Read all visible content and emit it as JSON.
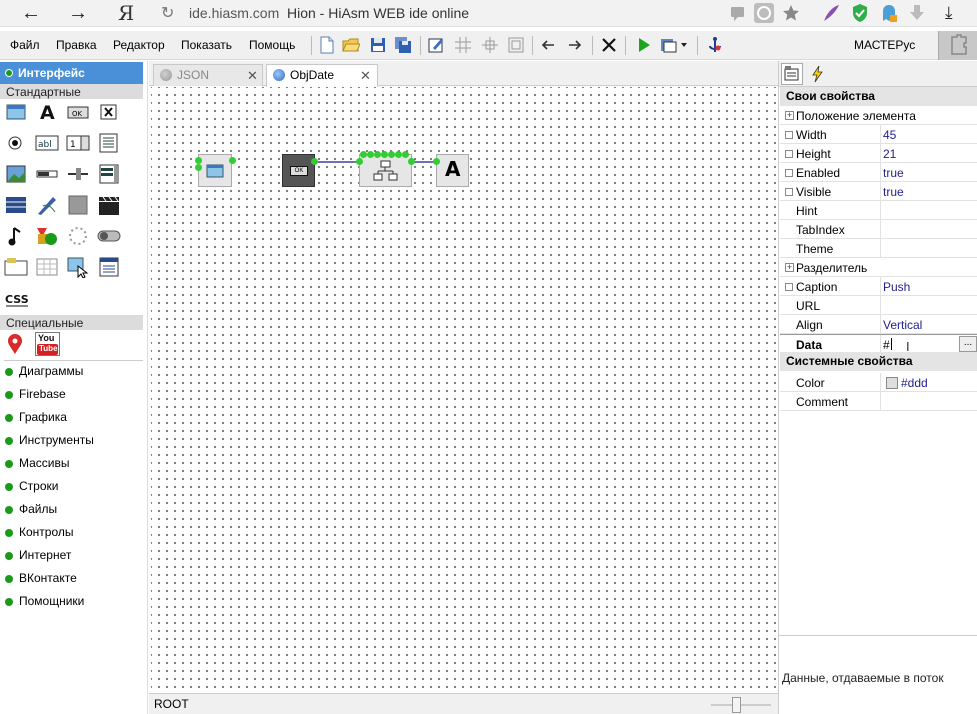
{
  "browser": {
    "back": "←",
    "forward": "→",
    "yandex": "Я",
    "reload": "↻",
    "url": "ide.hiasm.com",
    "title": "Hion - HiAsm WEB ide online",
    "download": "⤓"
  },
  "menu": {
    "items": [
      "Файл",
      "Правка",
      "Редактор",
      "Показать",
      "Помощь"
    ],
    "user": "МАСТЕРус"
  },
  "left": {
    "header": "Интерфейс",
    "section_standard": "Стандартные",
    "css_label": "CSS",
    "section_special": "Специальные",
    "youtube_top": "You",
    "youtube_bottom": "Tube",
    "categories": [
      "Диаграммы",
      "Firebase",
      "Графика",
      "Инструменты",
      "Массивы",
      "Строки",
      "Файлы",
      "Контролы",
      "Интернет",
      "ВКонтакте",
      "Помощники"
    ]
  },
  "tabs": [
    {
      "label": "JSON",
      "close": "✕"
    },
    {
      "label": "ObjDate",
      "close": "✕"
    }
  ],
  "canvas": {
    "node_ok_label": "OK",
    "node_label_glyph": "A"
  },
  "status": {
    "path": "ROOT"
  },
  "props": {
    "group_own": "Свои свойства",
    "position": "Положение элемента",
    "rows1": [
      {
        "name": "Width",
        "value": "45"
      },
      {
        "name": "Height",
        "value": "21"
      },
      {
        "name": "Enabled",
        "value": "true"
      },
      {
        "name": "Visible",
        "value": "true"
      },
      {
        "name": "Hint",
        "value": ""
      },
      {
        "name": "TabIndex",
        "value": ""
      },
      {
        "name": "Theme",
        "value": ""
      }
    ],
    "separator": "Разделитель",
    "rows2": [
      {
        "name": "Caption",
        "value": "Push"
      },
      {
        "name": "URL",
        "value": ""
      },
      {
        "name": "Align",
        "value": "Vertical"
      },
      {
        "name": "Data",
        "value": "#"
      }
    ],
    "data_button": "...",
    "group_system": "Системные свойства",
    "color_name": "Color",
    "color_value": "#ddd",
    "comment_name": "Comment",
    "hint": "Данные, отдаваемые в поток"
  },
  "colors": {
    "accent": "#4a90d9",
    "pin": "#33cc33",
    "link": "#1a1a8c"
  }
}
